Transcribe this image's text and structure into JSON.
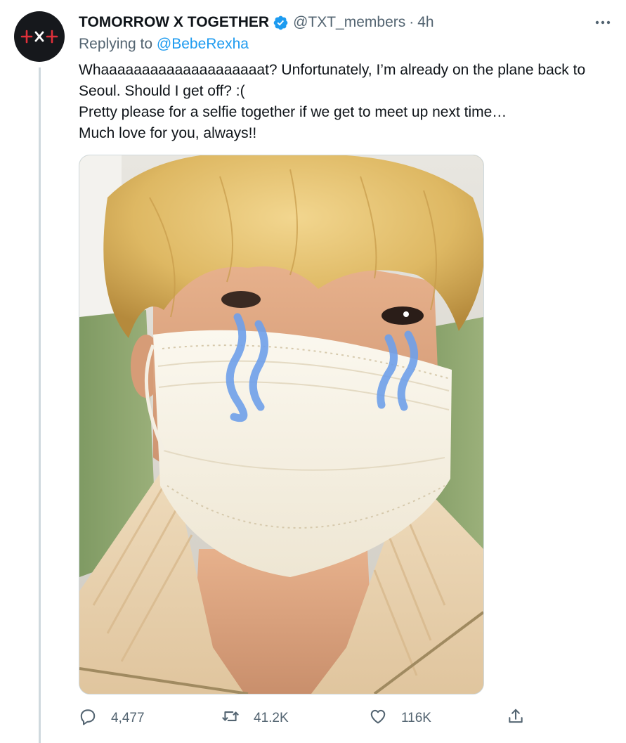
{
  "tweet": {
    "display_name": "TOMORROW X TOGETHER",
    "handle": "@TXT_members",
    "separator": "·",
    "time": "4h",
    "replying_prefix": "Replying to",
    "replying_to": "@BebeRexha",
    "text_lines": [
      "Whaaaaaaaaaaaaaaaaaaaat? Unfortunately, I’m already on the plane back to Seoul. Should I get off? :(",
      "Pretty please for a selfie together if we get to meet up next time…",
      "Much love for you, always!!"
    ]
  },
  "actions": {
    "replies": "4,477",
    "retweets": "41.2K",
    "likes": "116K"
  },
  "icons": {
    "avatar": "txt-logo",
    "verified": "verified-badge-icon",
    "more": "more-options-icon",
    "reply": "reply-icon",
    "retweet": "retweet-icon",
    "like": "heart-icon",
    "share": "share-icon"
  },
  "colors": {
    "accent": "#1d9bf0",
    "text": "#0f1419",
    "secondary": "#536471",
    "logo_red": "#e0303a"
  }
}
